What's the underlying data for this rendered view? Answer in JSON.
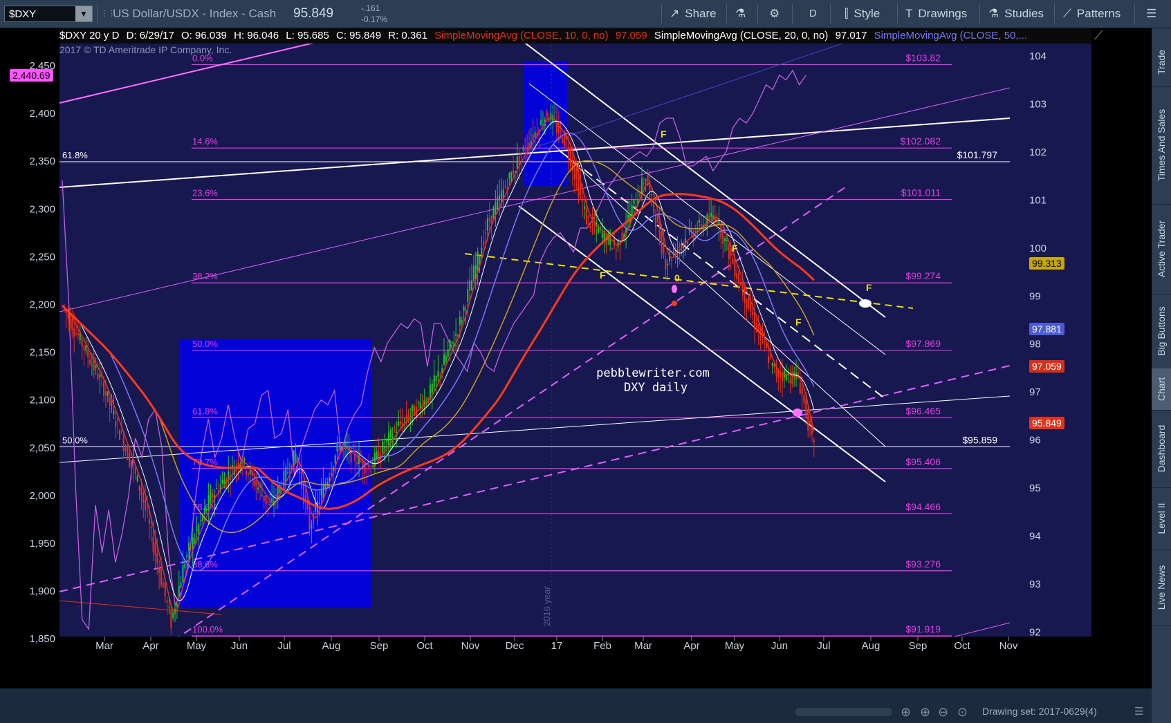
{
  "toolbar": {
    "symbol": "$DXY",
    "description": "US Dollar/USDX - Index - Cash",
    "last": "95.849",
    "change": "-.161",
    "change_pct": "-0.17%",
    "share": "Share",
    "period": "D",
    "style": "Style",
    "drawings": "Drawings",
    "studies": "Studies",
    "patterns": "Patterns"
  },
  "legend": {
    "symbol_period": "$DXY 20 y D",
    "date": "D: 6/29/17",
    "open": "O: 96.039",
    "high": "H: 96.046",
    "low": "L: 95.685",
    "close": "C: 95.849",
    "range": "R: 0.361",
    "sma10": "SimpleMovingAvg (CLOSE, 10, 0, no)",
    "sma10_val": "97.059",
    "sma20": "SimpleMovingAvg (CLOSE, 20, 0, no)",
    "sma20_val": "97.017",
    "sma50": "SimpleMovingAvg (CLOSE, 50,..."
  },
  "copyright": "2017 © TD Ameritrade IP Company, Inc.",
  "watermark": "pebblewriter.com\nDXY daily",
  "watermark_line1": "pebblewriter.com",
  "watermark_line2": "DXY daily",
  "year_marker": "2016 year",
  "left_axis": {
    "ticks": [
      "2,450",
      "2,400",
      "2,350",
      "2,300",
      "2,250",
      "2,200",
      "2,150",
      "2,100",
      "2,050",
      "2,000",
      "1,950",
      "1,900",
      "1,850"
    ],
    "current": "2,440.69"
  },
  "right_axis": {
    "ticks": [
      "104",
      "103",
      "102",
      "101",
      "100",
      "99",
      "98",
      "97",
      "96",
      "95",
      "94",
      "93",
      "92"
    ],
    "tags": [
      {
        "text": "99.313",
        "bg": "#c8a800",
        "fg": "#000000"
      },
      {
        "text": "97.881",
        "bg": "#4b5bd8",
        "fg": "#ffffff"
      },
      {
        "text": "97.059",
        "bg": "#d83018",
        "fg": "#ffffff"
      },
      {
        "text": "95.849",
        "bg": "#e83018",
        "fg": "#ffffff"
      }
    ]
  },
  "x_axis": {
    "labels": [
      "Mar",
      "Apr",
      "May",
      "Jun",
      "Jul",
      "Aug",
      "Sep",
      "Oct",
      "Nov",
      "Dec",
      "17",
      "Feb",
      "Mar",
      "Apr",
      "May",
      "Jun",
      "Jul",
      "Aug",
      "Sep",
      "Oct",
      "Nov"
    ]
  },
  "fib_levels": [
    {
      "pct": "0.0%",
      "price": "$103.82"
    },
    {
      "pct": "14.6%",
      "price": "$102.082"
    },
    {
      "pct": "23.6%",
      "price": "$101.011"
    },
    {
      "pct": "38.2%",
      "price": "$99.274"
    },
    {
      "pct": "50.0%",
      "price": "$97.869"
    },
    {
      "pct": "61.8%",
      "price": "$96.465"
    },
    {
      "pct": "70.7%",
      "price": "$95.406"
    },
    {
      "pct": "78.6%",
      "price": "$94.466"
    },
    {
      "pct": "88.6%",
      "price": "$93.276"
    },
    {
      "pct": "100.0%",
      "price": "$91.919"
    }
  ],
  "white_levels": [
    {
      "label": "61.8%",
      "price": "$101.797"
    },
    {
      "label": "50.0%",
      "price": "$95.859"
    }
  ],
  "f_markers": [
    "F",
    "F",
    "F",
    "F",
    "F"
  ],
  "bottom": {
    "drawing_set": "Drawing set: 2017-0629(4)"
  },
  "sidebar": [
    "Trade",
    "Times And Sales",
    "Active Trader",
    "Big Buttons",
    "Chart",
    "Dashboard",
    "Level II",
    "Live News"
  ],
  "colors": {
    "plot_bg": "#181850",
    "fib": "#e040e0",
    "sma10": "#e83018",
    "sma20": "#ffffff",
    "sma50": "#7878ff",
    "sma100": "#c8a020",
    "sma200": "#ff3a1a",
    "spx": "#c060e0",
    "up_candle": "#1ec81e",
    "down_candle": "#e83018",
    "highlight": "#0000ee"
  }
}
